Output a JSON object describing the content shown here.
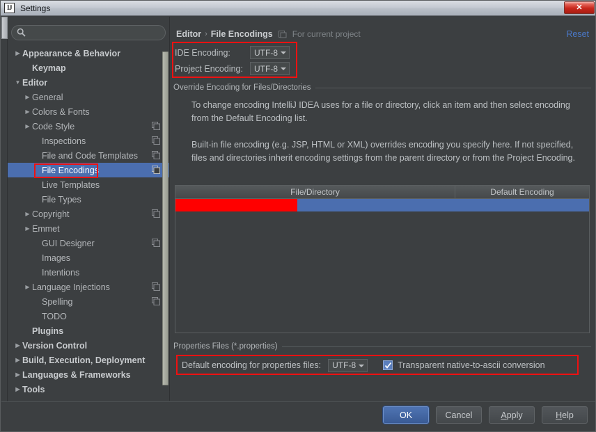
{
  "window": {
    "title": "Settings",
    "logo_text": "IJ",
    "close_label": "✕"
  },
  "sidebar": {
    "search": {
      "value": "",
      "placeholder": ""
    },
    "items": [
      {
        "label": "Appearance & Behavior",
        "indent": 0,
        "arrow": "collapsed",
        "bold": true,
        "badge": false,
        "selected": false
      },
      {
        "label": "Keymap",
        "indent": 1,
        "arrow": "none",
        "bold": true,
        "badge": false,
        "selected": false
      },
      {
        "label": "Editor",
        "indent": 0,
        "arrow": "expanded",
        "bold": true,
        "badge": false,
        "selected": false
      },
      {
        "label": "General",
        "indent": 1,
        "arrow": "collapsed",
        "bold": false,
        "badge": false,
        "selected": false
      },
      {
        "label": "Colors & Fonts",
        "indent": 1,
        "arrow": "collapsed",
        "bold": false,
        "badge": false,
        "selected": false
      },
      {
        "label": "Code Style",
        "indent": 1,
        "arrow": "collapsed",
        "bold": false,
        "badge": true,
        "selected": false
      },
      {
        "label": "Inspections",
        "indent": 2,
        "arrow": "none",
        "bold": false,
        "badge": true,
        "selected": false
      },
      {
        "label": "File and Code Templates",
        "indent": 2,
        "arrow": "none",
        "bold": false,
        "badge": true,
        "selected": false
      },
      {
        "label": "File Encodings",
        "indent": 2,
        "arrow": "none",
        "bold": false,
        "badge": true,
        "selected": true
      },
      {
        "label": "Live Templates",
        "indent": 2,
        "arrow": "none",
        "bold": false,
        "badge": false,
        "selected": false
      },
      {
        "label": "File Types",
        "indent": 2,
        "arrow": "none",
        "bold": false,
        "badge": false,
        "selected": false
      },
      {
        "label": "Copyright",
        "indent": 1,
        "arrow": "collapsed",
        "bold": false,
        "badge": true,
        "selected": false
      },
      {
        "label": "Emmet",
        "indent": 1,
        "arrow": "collapsed",
        "bold": false,
        "badge": false,
        "selected": false
      },
      {
        "label": "GUI Designer",
        "indent": 2,
        "arrow": "none",
        "bold": false,
        "badge": true,
        "selected": false
      },
      {
        "label": "Images",
        "indent": 2,
        "arrow": "none",
        "bold": false,
        "badge": false,
        "selected": false
      },
      {
        "label": "Intentions",
        "indent": 2,
        "arrow": "none",
        "bold": false,
        "badge": false,
        "selected": false
      },
      {
        "label": "Language Injections",
        "indent": 1,
        "arrow": "collapsed",
        "bold": false,
        "badge": true,
        "selected": false
      },
      {
        "label": "Spelling",
        "indent": 2,
        "arrow": "none",
        "bold": false,
        "badge": true,
        "selected": false
      },
      {
        "label": "TODO",
        "indent": 2,
        "arrow": "none",
        "bold": false,
        "badge": false,
        "selected": false
      },
      {
        "label": "Plugins",
        "indent": 1,
        "arrow": "none",
        "bold": true,
        "badge": false,
        "selected": false
      },
      {
        "label": "Version Control",
        "indent": 0,
        "arrow": "collapsed",
        "bold": true,
        "badge": false,
        "selected": false
      },
      {
        "label": "Build, Execution, Deployment",
        "indent": 0,
        "arrow": "collapsed",
        "bold": true,
        "badge": false,
        "selected": false
      },
      {
        "label": "Languages & Frameworks",
        "indent": 0,
        "arrow": "collapsed",
        "bold": true,
        "badge": false,
        "selected": false
      },
      {
        "label": "Tools",
        "indent": 0,
        "arrow": "collapsed",
        "bold": true,
        "badge": false,
        "selected": false
      }
    ]
  },
  "content": {
    "breadcrumb": {
      "parent": "Editor",
      "separator": "›",
      "current": "File Encodings",
      "note": "For current project"
    },
    "reset_label": "Reset",
    "encodings": {
      "ide_label": "IDE Encoding:",
      "ide_value": "UTF-8",
      "project_label": "Project Encoding:",
      "project_value": "UTF-8"
    },
    "override_group": {
      "title": "Override Encoding for Files/Directories",
      "paragraph1": "To change encoding IntelliJ IDEA uses for a file or directory, click an item and then select encoding from the Default Encoding list.",
      "paragraph2": "Built-in file encoding (e.g. JSP, HTML or XML) overrides encoding you specify here. If not specified, files and directories inherit encoding settings from the parent directory or from the Project Encoding."
    },
    "table": {
      "columns": [
        "File/Directory",
        "Default Encoding"
      ],
      "rows": [
        {
          "file_directory": "",
          "default_encoding": "",
          "selected": true,
          "redacted": true
        }
      ]
    },
    "properties_group": {
      "title": "Properties Files (*.properties)",
      "default_encoding_label": "Default encoding for properties files:",
      "default_encoding_value": "UTF-8",
      "native_ascii_label": "Transparent native-to-ascii conversion",
      "native_ascii_checked": true
    }
  },
  "footer": {
    "buttons": [
      {
        "label": "OK",
        "default": true,
        "mnemonic": ""
      },
      {
        "label": "Cancel",
        "default": false,
        "mnemonic": ""
      },
      {
        "label": "Apply",
        "default": false,
        "mnemonic": "A"
      },
      {
        "label": "Help",
        "default": false,
        "mnemonic": "H"
      }
    ]
  },
  "colors": {
    "window_bg": "#3c3f41",
    "selection_blue": "#4b6eaf",
    "annotation_red": "#ee1111",
    "redacted_red": "#ff0000",
    "link_blue": "#4a78c8",
    "titlebar_dark_text": "#14171a"
  }
}
